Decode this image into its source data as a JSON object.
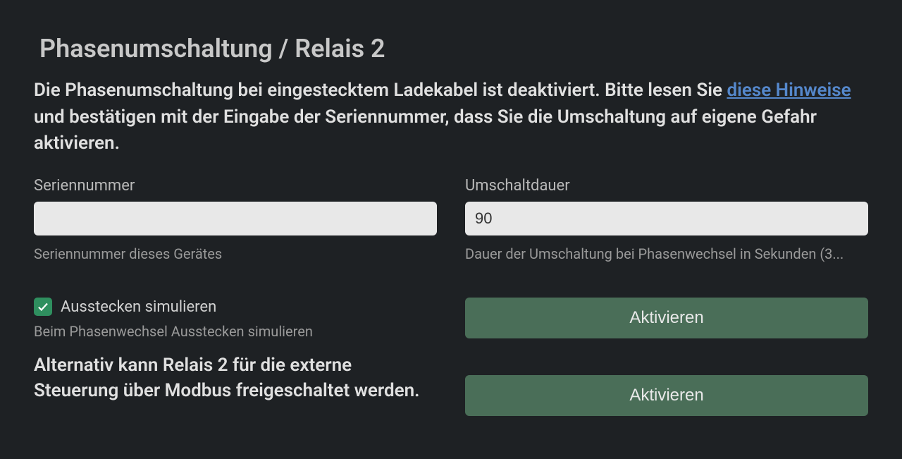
{
  "title": "Phasenumschaltung / Relais 2",
  "description": {
    "prefix": "Die Phasenumschaltung bei eingestecktem Ladekabel ist deaktiviert. Bitte lesen Sie ",
    "link_text": "diese Hinweise",
    "suffix": " und bestätigen mit der Eingabe der Seriennummer, dass Sie die Umschaltung auf eigene Gefahr aktivieren."
  },
  "serial": {
    "label": "Seriennummer",
    "value": "",
    "help": "Seriennummer dieses Gerätes"
  },
  "duration": {
    "label": "Umschaltdauer",
    "value": "90",
    "help": "Dauer der Umschaltung bei Phasenwechsel in Sekunden (3..."
  },
  "simulate": {
    "label": "Ausstecken simulieren",
    "help": "Beim Phasenwechsel Ausstecken simulieren",
    "checked": true
  },
  "alternative_text": "Alternativ kann Relais 2 für die externe Steuerung über Modbus freigeschaltet werden.",
  "buttons": {
    "activate1": "Aktivieren",
    "activate2": "Aktivieren"
  }
}
